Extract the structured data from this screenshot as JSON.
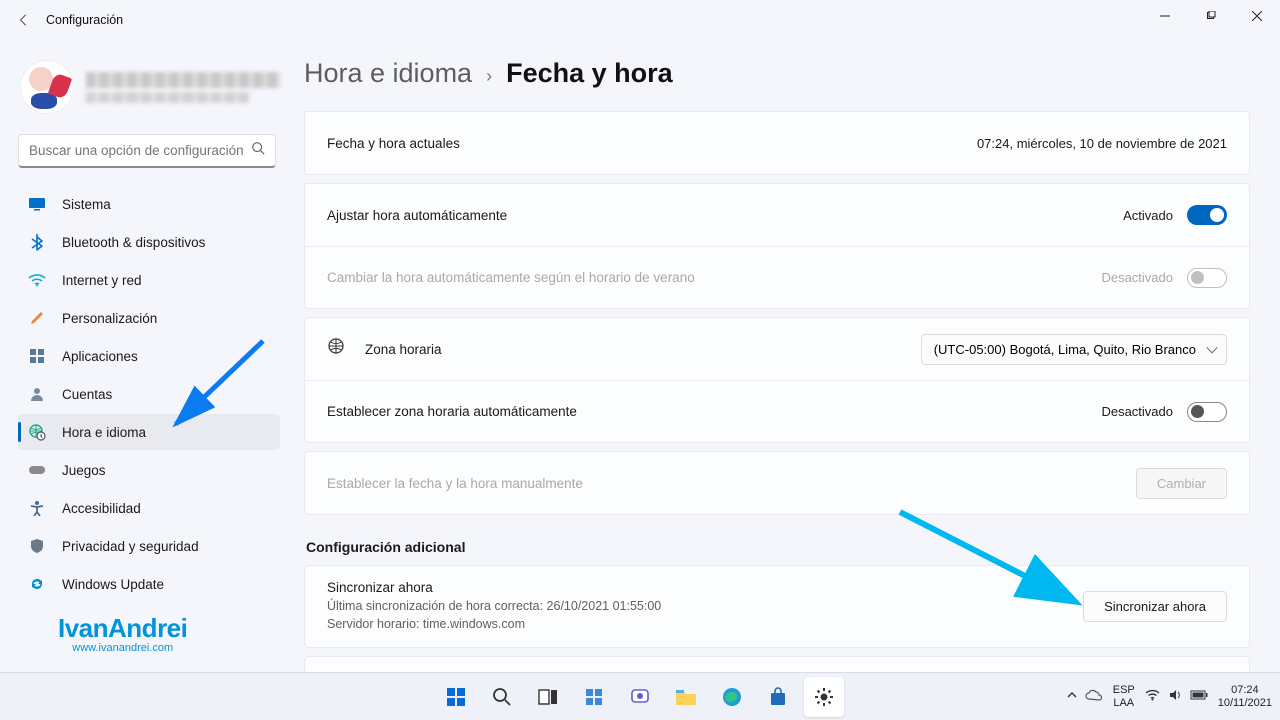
{
  "titlebar": {
    "title": "Configuración"
  },
  "search": {
    "placeholder": "Buscar una opción de configuración"
  },
  "sidebar": {
    "items": [
      {
        "label": "Sistema",
        "icon": "display"
      },
      {
        "label": "Bluetooth & dispositivos",
        "icon": "bluetooth"
      },
      {
        "label": "Internet y red",
        "icon": "wifi"
      },
      {
        "label": "Personalización",
        "icon": "brush"
      },
      {
        "label": "Aplicaciones",
        "icon": "apps"
      },
      {
        "label": "Cuentas",
        "icon": "person"
      },
      {
        "label": "Hora e idioma",
        "icon": "globe-clock"
      },
      {
        "label": "Juegos",
        "icon": "gamepad"
      },
      {
        "label": "Accesibilidad",
        "icon": "accessibility"
      },
      {
        "label": "Privacidad y seguridad",
        "icon": "shield"
      },
      {
        "label": "Windows Update",
        "icon": "update"
      }
    ],
    "active_index": 6
  },
  "breadcrumb": {
    "parent": "Hora e idioma",
    "current": "Fecha y hora"
  },
  "rows": {
    "current": {
      "label": "Fecha y hora actuales",
      "value": "07:24, miércoles, 10 de noviembre de 2021"
    },
    "auto_time": {
      "label": "Ajustar hora automáticamente",
      "state": "Activado",
      "on": true
    },
    "dst": {
      "label": "Cambiar la hora automáticamente según el horario de verano",
      "state": "Desactivado",
      "on": false,
      "disabled": true
    },
    "timezone": {
      "label": "Zona horaria",
      "value": "(UTC-05:00) Bogotá, Lima, Quito, Rio Branco"
    },
    "auto_tz": {
      "label": "Establecer zona horaria automáticamente",
      "state": "Desactivado",
      "on": false
    },
    "manual": {
      "label": "Establecer la fecha y la hora manualmente",
      "button": "Cambiar",
      "disabled": true
    }
  },
  "additional": {
    "title": "Configuración adicional",
    "sync": {
      "title": "Sincronizar ahora",
      "last": "Última sincronización de hora correcta: 26/10/2021 01:55:00",
      "server": "Servidor horario: time.windows.com",
      "button": "Sincronizar ahora"
    }
  },
  "watermark": {
    "big": "IvanAndrei",
    "small": "www.ivanandrei.com"
  },
  "taskbar": {
    "lang1": "ESP",
    "lang2": "LAA",
    "time": "07:24",
    "date": "10/11/2021"
  }
}
